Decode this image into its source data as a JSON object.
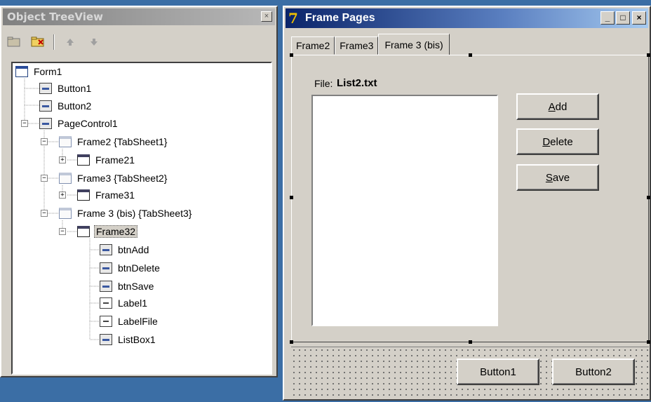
{
  "tree_window": {
    "title": "Object TreeView",
    "close_label": "×",
    "toolbar": [
      "new-folder-icon",
      "new-item-icon",
      "up-arrow-icon",
      "down-arrow-icon"
    ],
    "nodes": [
      {
        "label": "Form1",
        "icon": "form-icon",
        "expander": ""
      },
      {
        "label": "Button1",
        "icon": "button-icon",
        "expander": ""
      },
      {
        "label": "Button2",
        "icon": "button-icon",
        "expander": ""
      },
      {
        "label": "PageControl1",
        "icon": "pagecontrol-icon",
        "expander": "−"
      },
      {
        "label": "Frame2 {TabSheet1}",
        "icon": "tabsheet-icon",
        "expander": "−"
      },
      {
        "label": "Frame21",
        "icon": "frame-icon",
        "expander": "+"
      },
      {
        "label": "Frame3 {TabSheet2}",
        "icon": "tabsheet-icon",
        "expander": "−"
      },
      {
        "label": "Frame31",
        "icon": "frame-icon",
        "expander": "+"
      },
      {
        "label": "Frame 3 (bis) {TabSheet3}",
        "icon": "tabsheet-icon",
        "expander": "−"
      },
      {
        "label": "Frame32",
        "icon": "frame-icon",
        "expander": "−",
        "selected": true
      },
      {
        "label": "btnAdd",
        "icon": "button-icon",
        "expander": ""
      },
      {
        "label": "btnDelete",
        "icon": "button-icon",
        "expander": ""
      },
      {
        "label": "btnSave",
        "icon": "button-icon",
        "expander": ""
      },
      {
        "label": "Label1",
        "icon": "label-icon",
        "expander": ""
      },
      {
        "label": "LabelFile",
        "icon": "label-icon",
        "expander": ""
      },
      {
        "label": "ListBox1",
        "icon": "listbox-icon",
        "expander": ""
      }
    ]
  },
  "frame_window": {
    "title": "Frame Pages",
    "app_icon": "7",
    "caption_buttons": {
      "minimize": "_",
      "maximize": "□",
      "close": "×"
    },
    "tabs": [
      {
        "label": "Frame2",
        "active": false
      },
      {
        "label": "Frame3",
        "active": false
      },
      {
        "label": "Frame 3 (bis)",
        "active": true
      }
    ],
    "file_label": "File:",
    "file_name": "List2.txt",
    "buttons": {
      "add": {
        "accel": "A",
        "rest": "dd"
      },
      "delete": {
        "accel": "D",
        "rest": "elete"
      },
      "save": {
        "accel": "S",
        "rest": "ave"
      }
    },
    "bottom_buttons": {
      "button1": "Button1",
      "button2": "Button2"
    }
  },
  "colors": {
    "desktop": "#3b6ea5",
    "active_title_start": "#0a246a",
    "inactive_title": "#808080",
    "face": "#d4d0c8"
  }
}
